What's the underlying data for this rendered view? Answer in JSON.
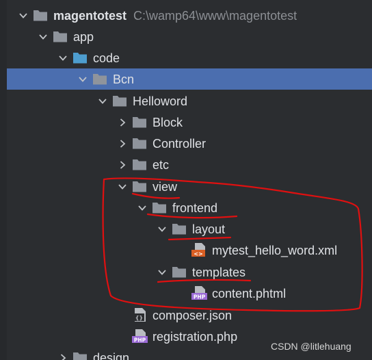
{
  "project": {
    "name": "magentotest",
    "path": "C:\\wamp64\\www\\magentotest"
  },
  "tree": [
    {
      "label": "app",
      "icon": "folder-icon",
      "expanded": true
    },
    {
      "label": "code",
      "icon": "source-folder-icon",
      "expanded": true
    },
    {
      "label": "Bcn",
      "icon": "folder-icon",
      "expanded": true,
      "selected": true
    },
    {
      "label": "Helloword",
      "icon": "folder-icon",
      "expanded": true
    },
    {
      "label": "Block",
      "icon": "folder-icon",
      "expanded": false
    },
    {
      "label": "Controller",
      "icon": "folder-icon",
      "expanded": false
    },
    {
      "label": "etc",
      "icon": "folder-icon",
      "expanded": false
    },
    {
      "label": "view",
      "icon": "folder-icon",
      "expanded": true
    },
    {
      "label": "frontend",
      "icon": "folder-icon",
      "expanded": true
    },
    {
      "label": "layout",
      "icon": "folder-icon",
      "expanded": true
    },
    {
      "label": "mytest_hello_word.xml",
      "icon": "xml-file-icon"
    },
    {
      "label": "templates",
      "icon": "folder-icon",
      "expanded": true
    },
    {
      "label": "content.phtml",
      "icon": "php-file-icon"
    },
    {
      "label": "composer.json",
      "icon": "json-file-icon"
    },
    {
      "label": "registration.php",
      "icon": "php-file-icon"
    },
    {
      "label": "design",
      "icon": "folder-icon",
      "expanded": false
    }
  ],
  "file_badges": {
    "php": "PHP",
    "json": "{}",
    "xml": "<>"
  },
  "colors": {
    "background": "#2b2d30",
    "selection": "#4b6eaf",
    "folder": "#8f949c",
    "source_folder": "#4d9dcf",
    "annotation": "#e01010",
    "php_icon": "#9b6bd6",
    "xml_icon": "#d95f24"
  },
  "watermark": "CSDN @litlehuang"
}
